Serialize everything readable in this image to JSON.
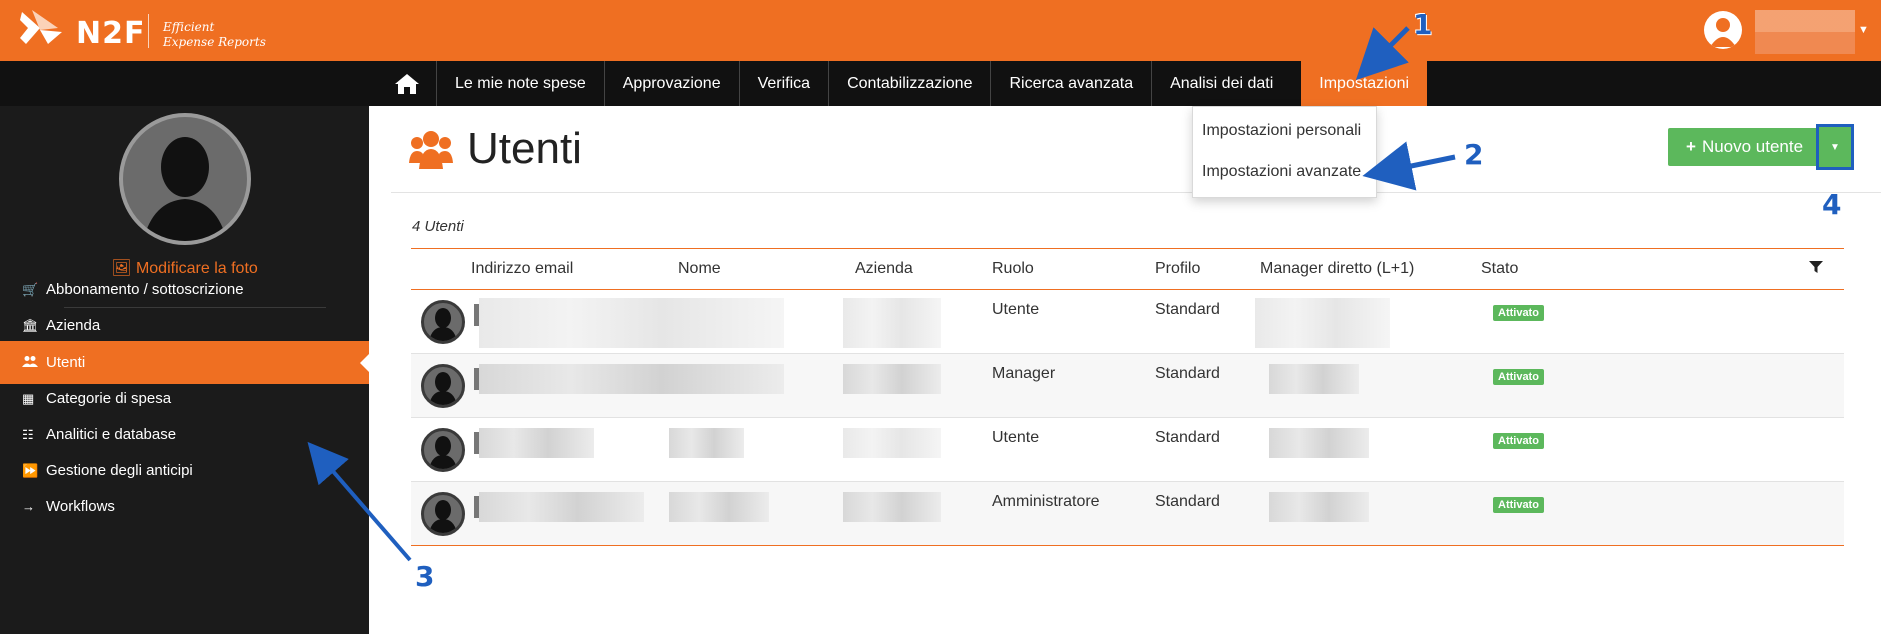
{
  "app": {
    "brand": "N2F",
    "tagline_line1": "Efficient",
    "tagline_line2": "Expense Reports"
  },
  "top_nav": {
    "items": [
      {
        "label": "Le mie note spese"
      },
      {
        "label": "Approvazione"
      },
      {
        "label": "Verifica"
      },
      {
        "label": "Contabilizzazione"
      },
      {
        "label": "Ricerca avanzata"
      },
      {
        "label": "Analisi dei dati"
      },
      {
        "label": "Impostazioni",
        "active": true
      }
    ]
  },
  "dropdown": {
    "items": [
      {
        "label": "Impostazioni personali"
      },
      {
        "label": "Impostazioni avanzate"
      }
    ]
  },
  "sidebar": {
    "change_photo": "Modificare la foto",
    "items": [
      {
        "label": "Abbonamento / sottoscrizione",
        "icon": "cart-icon"
      },
      {
        "label": "Azienda",
        "icon": "bank-icon"
      },
      {
        "label": "Utenti",
        "icon": "users-icon",
        "active": true
      },
      {
        "label": "Categorie di spesa",
        "icon": "grid-icon"
      },
      {
        "label": "Analitici e database",
        "icon": "table-icon"
      },
      {
        "label": "Gestione degli anticipi",
        "icon": "fast-forward-icon"
      },
      {
        "label": "Workflows",
        "icon": "arrow-right-icon"
      }
    ]
  },
  "page": {
    "title": "Utenti",
    "new_user_button": "Nuovo utente",
    "user_count": "4 Utenti"
  },
  "table": {
    "columns": [
      "Indirizzo email",
      "Nome",
      "Azienda",
      "Ruolo",
      "Profilo",
      "Manager diretto (L+1)",
      "Stato"
    ],
    "rows": [
      {
        "ruolo": "Utente",
        "profilo": "Standard",
        "stato": "Attivato"
      },
      {
        "ruolo": "Manager",
        "profilo": "Standard",
        "stato": "Attivato"
      },
      {
        "ruolo": "Utente",
        "profilo": "Standard",
        "stato": "Attivato"
      },
      {
        "ruolo": "Amministratore",
        "profilo": "Standard",
        "stato": "Attivato"
      }
    ]
  },
  "annotations": [
    "1",
    "2",
    "3",
    "4"
  ],
  "colors": {
    "brand_orange": "#ef6f22",
    "menubar": "#111111",
    "sidebar": "#1b1b1b",
    "success_green": "#5cb85c",
    "annotation_blue": "#1f5fbf"
  }
}
